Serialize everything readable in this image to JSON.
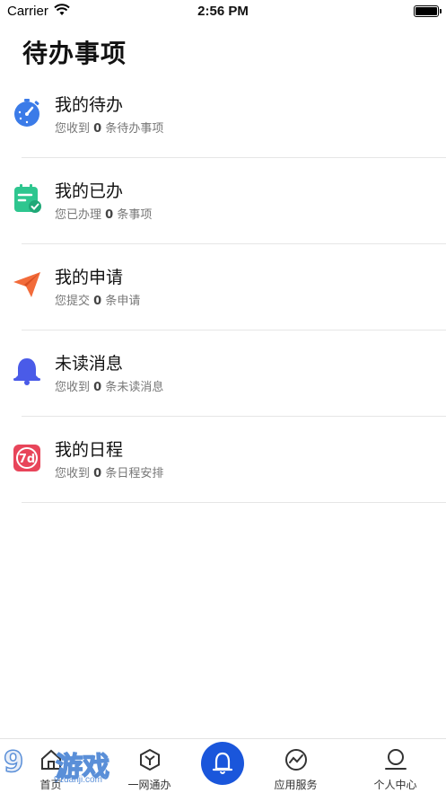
{
  "status_bar": {
    "carrier": "Carrier",
    "time": "2:56 PM"
  },
  "page_title": "待办事项",
  "items": [
    {
      "title": "我的待办",
      "sub_pre": "您收到 ",
      "count": "0",
      "sub_post": " 条待办事项",
      "icon": "stopwatch-icon",
      "color": "#3b7be8"
    },
    {
      "title": "我的已办",
      "sub_pre": "您已办理 ",
      "count": "0",
      "sub_post": " 条事项",
      "icon": "checklist-icon",
      "color": "#2ec68f"
    },
    {
      "title": "我的申请",
      "sub_pre": "您提交 ",
      "count": "0",
      "sub_post": " 条申请",
      "icon": "paper-plane-icon",
      "color": "#f26b3a"
    },
    {
      "title": "未读消息",
      "sub_pre": "您收到 ",
      "count": "0",
      "sub_post": " 条未读消息",
      "icon": "bell-icon",
      "color": "#4a5be8"
    },
    {
      "title": "我的日程",
      "sub_pre": "您收到 ",
      "count": "0",
      "sub_post": " 条日程安排",
      "icon": "calendar-7d-icon",
      "color": "#e8455a"
    }
  ],
  "tabs": [
    {
      "label": "首页",
      "icon": "home-icon"
    },
    {
      "label": "一网通办",
      "icon": "cube-icon"
    },
    {
      "label": "",
      "icon": "bell-icon"
    },
    {
      "label": "应用服务",
      "icon": "trend-icon"
    },
    {
      "label": "个人中心",
      "icon": "user-icon"
    }
  ],
  "watermark": {
    "big": "9",
    "brand": "游戏",
    "url": "91danji.com"
  },
  "colors": {
    "accent": "#1a56db"
  }
}
